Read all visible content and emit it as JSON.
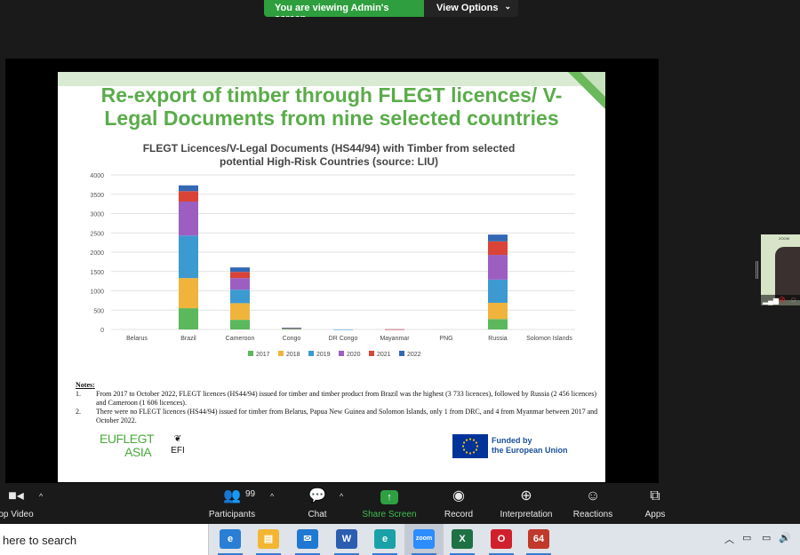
{
  "banner": {
    "label": "You are viewing Admin's screen",
    "options": "View Options"
  },
  "slide": {
    "title": "Re-export of timber through FLEGT licences/ V-Legal Documents from nine selected countries",
    "title_line1": "Re-export of timber through FLEGT licences/ V-",
    "title_line2": "Legal Documents from nine selected countries"
  },
  "chart_data": {
    "type": "bar",
    "stacked": true,
    "title_line1": "FLEGT Licences/V-Legal Documents (HS44/94) with Timber from selected",
    "title_line2": "potential High-Risk Countries (source: LIU)",
    "categories": [
      "Belarus",
      "Brazil",
      "Cameroon",
      "Congo",
      "DR Congo",
      "Mayanmar",
      "PNG",
      "Russia",
      "Solomon Islands"
    ],
    "ylim": [
      0,
      4000
    ],
    "yticks": [
      0,
      500,
      1000,
      1500,
      2000,
      2500,
      3000,
      3500,
      4000
    ],
    "grid": true,
    "legend_position": "bottom",
    "series": [
      {
        "name": "2017",
        "color": "#5cb85c",
        "values": [
          0,
          550,
          250,
          10,
          0,
          0,
          0,
          270,
          0
        ]
      },
      {
        "name": "2018",
        "color": "#f0b43c",
        "values": [
          0,
          780,
          430,
          10,
          0,
          0,
          0,
          420,
          0
        ]
      },
      {
        "name": "2019",
        "color": "#3d9ad1",
        "values": [
          0,
          1100,
          350,
          10,
          1,
          2,
          0,
          600,
          0
        ]
      },
      {
        "name": "2020",
        "color": "#9c5fc1",
        "values": [
          0,
          880,
          300,
          5,
          0,
          1,
          0,
          640,
          0
        ]
      },
      {
        "name": "2021",
        "color": "#d94437",
        "values": [
          0,
          270,
          160,
          5,
          0,
          1,
          0,
          350,
          0
        ]
      },
      {
        "name": "2022",
        "color": "#3468b5",
        "values": [
          0,
          150,
          116,
          5,
          0,
          0,
          0,
          176,
          0
        ]
      }
    ]
  },
  "notes": {
    "heading": "Notes",
    "items": [
      {
        "num": "1.",
        "text": "From 2017 to October 2022, FLEGT licences (HS44/94) issued for timber and timber product from Brazil was the highest (3 733 licences), followed by Russia (2 456 licences) and Cameroon (1 606 licences)."
      },
      {
        "num": "2.",
        "text": "There were no FLEGT licences (HS44/94) issued for timber from Belarus, Papua New Guinea and Solomon Islands, only 1 from DRC, and 4 from Myanmar between 2017 and October 2022."
      }
    ]
  },
  "logos": {
    "euflegt_line1": "EUFLEGT",
    "euflegt_line2": "ASIA",
    "efi": "EFI",
    "eu_line1": "Funded by",
    "eu_line2": "the European Union"
  },
  "thumbnail": {
    "label": "ZOOM"
  },
  "toolbar": {
    "video": "op Video",
    "participants": "Participants",
    "participants_count": "99",
    "chat": "Chat",
    "share": "Share Screen",
    "record": "Record",
    "interpretation": "Interpretation",
    "reactions": "Reactions",
    "apps": "Apps"
  },
  "taskbar": {
    "search_text": "here to search",
    "apps": [
      {
        "name": "Edge-like browser",
        "glyph": "e",
        "color": "#2a7fd4"
      },
      {
        "name": "File Explorer",
        "glyph": "▤",
        "color": "#f2b632"
      },
      {
        "name": "Mail",
        "glyph": "✉",
        "color": "#1f78d1"
      },
      {
        "name": "Word",
        "glyph": "W",
        "color": "#2b5eb0"
      },
      {
        "name": "Edge",
        "glyph": "e",
        "color": "#1aa1a8"
      },
      {
        "name": "Zoom",
        "glyph": "zoom",
        "color": "#2d8cff"
      },
      {
        "name": "Excel",
        "glyph": "X",
        "color": "#1e7145"
      },
      {
        "name": "Opera",
        "glyph": "O",
        "color": "#d0202e"
      },
      {
        "name": "Other app",
        "glyph": "64",
        "color": "#c0392b"
      }
    ]
  }
}
